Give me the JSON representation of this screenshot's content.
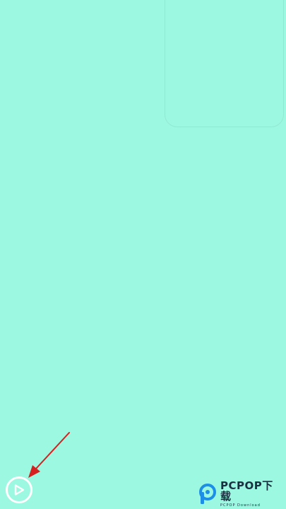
{
  "colors": {
    "background": "#9cf8e0",
    "play_button": "#ffffff",
    "annotation_arrow": "#d62020",
    "watermark_blue": "#1e8fe6",
    "watermark_dark": "#1a3040"
  },
  "icons": {
    "play_button": "play-circle-icon",
    "watermark_logo": "pcpop-logo-icon"
  },
  "watermark": {
    "text": "PCPOP下载",
    "subtext": "PCPOP Download"
  }
}
